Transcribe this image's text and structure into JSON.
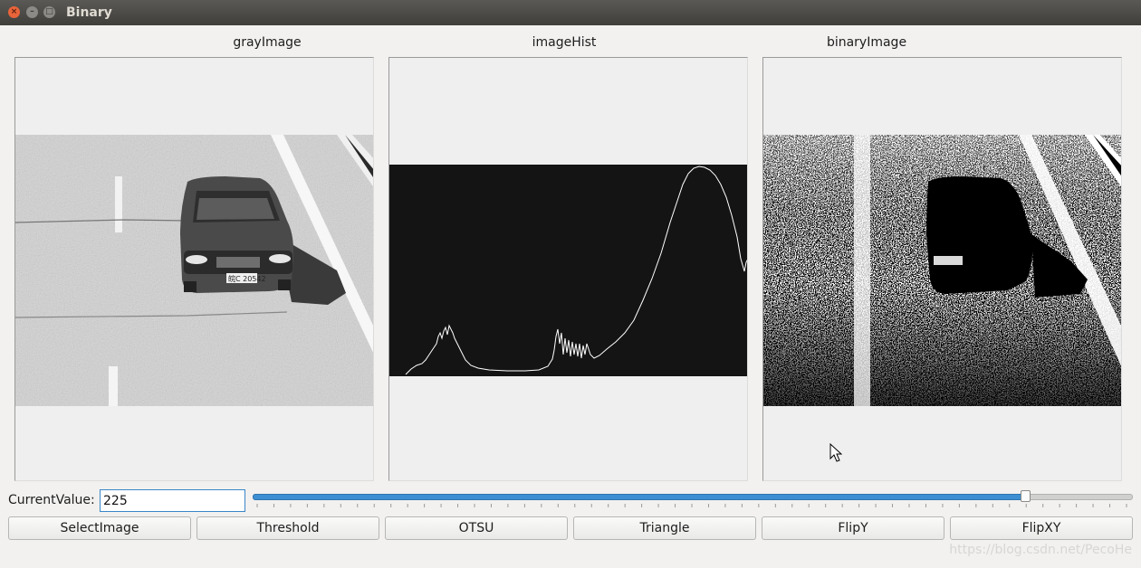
{
  "window": {
    "title": "Binary"
  },
  "panels": {
    "gray": {
      "caption": "grayImage"
    },
    "hist": {
      "caption": "imageHist"
    },
    "binary": {
      "caption": "binaryImage"
    }
  },
  "controls": {
    "current_label": "CurrentValue:",
    "current_value": "225",
    "slider": {
      "value": 225,
      "min": 0,
      "max": 255
    }
  },
  "buttons": [
    "SelectImage",
    "Threshold",
    "OTSU",
    "Triangle",
    "FlipY",
    "FlipXY"
  ],
  "plate_text": "皖C 20542",
  "watermark": "https://blog.csdn.net/PecoHe",
  "colors": {
    "accent": "#3d8fd2",
    "hist_bg": "#141414"
  }
}
